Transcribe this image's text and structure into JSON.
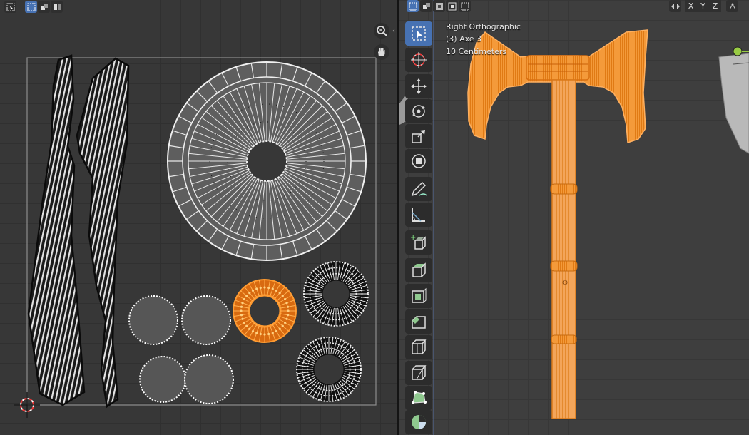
{
  "uv_editor": {
    "header_icons": [
      "select-box-icon",
      "select-mode-icon",
      "sync-mode-icon"
    ],
    "nav_icons": [
      "zoom-icon",
      "pan-hand-icon"
    ]
  },
  "viewport": {
    "overlay": {
      "view_name": "Right Orthographic",
      "object_name": "(3) Axe 3",
      "grid_scale": "10 Centimeters"
    },
    "axis_buttons": [
      "X",
      "Y",
      "Z"
    ],
    "toolbar": [
      {
        "name": "select-box-icon",
        "active": true
      },
      {
        "name": "cursor-icon",
        "active": false
      },
      {
        "name": "move-icon",
        "active": false
      },
      {
        "name": "rotate-icon",
        "active": false
      },
      {
        "name": "scale-icon",
        "active": false
      },
      {
        "name": "transform-icon",
        "active": false
      },
      {
        "name": "annotate-icon",
        "active": false
      },
      {
        "name": "measure-icon",
        "active": false
      },
      {
        "name": "add-cube-icon",
        "active": false
      },
      {
        "name": "extrude-region-icon",
        "active": false
      },
      {
        "name": "inset-faces-icon",
        "active": false
      },
      {
        "name": "bevel-icon",
        "active": false
      },
      {
        "name": "loop-cut-icon",
        "active": false
      },
      {
        "name": "knife-icon",
        "active": false
      },
      {
        "name": "poly-build-icon",
        "active": false
      },
      {
        "name": "spin-icon",
        "active": false
      }
    ]
  },
  "colors": {
    "selection": "#f08a1e",
    "active_tool": "#4772b3",
    "mesh_white": "#e6e6e6",
    "mesh_face": "#5c5c5c"
  }
}
